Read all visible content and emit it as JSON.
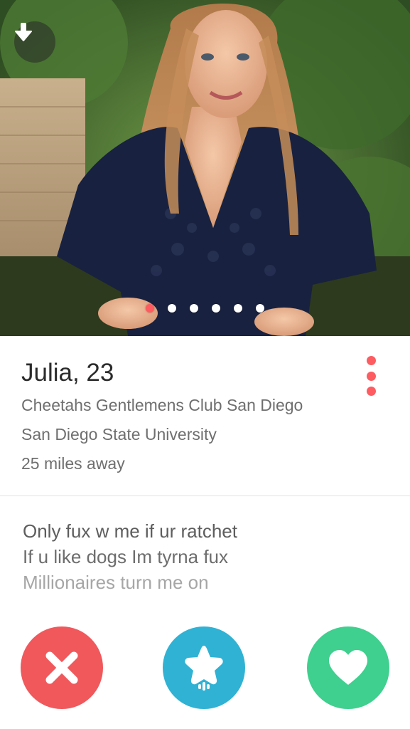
{
  "profile": {
    "name_age": "Julia, 23",
    "job": "Cheetahs Gentlemens Club San Diego",
    "school": "San Diego State University",
    "distance": "25 miles away"
  },
  "bio": {
    "lines": [
      "Only fux w me if ur ratchet",
      "If u like dogs Im tyrna fux",
      "Millionaires turn me on"
    ]
  },
  "photo": {
    "page_count": 6,
    "active_page": 1
  },
  "icons": {
    "collapse": "arrow-down-icon",
    "more": "more-vertical-icon",
    "nope": "close-icon",
    "superlike": "star-icon",
    "like": "heart-icon"
  },
  "colors": {
    "nope": "#f0585c",
    "superlike": "#2fb2d4",
    "like": "#3fcf8e",
    "accent": "#fd5c61"
  }
}
